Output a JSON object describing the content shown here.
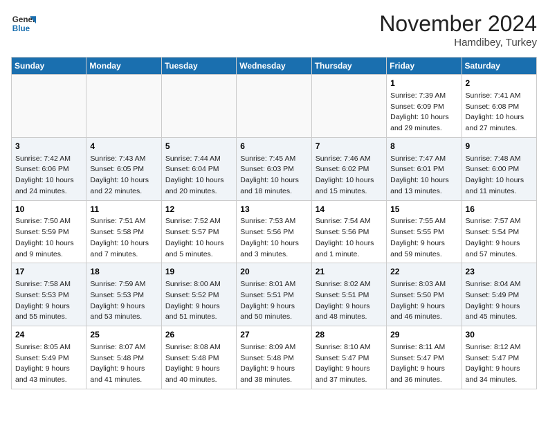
{
  "logo": {
    "line1": "General",
    "line2": "Blue"
  },
  "title": "November 2024",
  "location": "Hamdibey, Turkey",
  "days_of_week": [
    "Sunday",
    "Monday",
    "Tuesday",
    "Wednesday",
    "Thursday",
    "Friday",
    "Saturday"
  ],
  "weeks": [
    [
      {
        "day": "",
        "info": ""
      },
      {
        "day": "",
        "info": ""
      },
      {
        "day": "",
        "info": ""
      },
      {
        "day": "",
        "info": ""
      },
      {
        "day": "",
        "info": ""
      },
      {
        "day": "1",
        "info": "Sunrise: 7:39 AM\nSunset: 6:09 PM\nDaylight: 10 hours\nand 29 minutes."
      },
      {
        "day": "2",
        "info": "Sunrise: 7:41 AM\nSunset: 6:08 PM\nDaylight: 10 hours\nand 27 minutes."
      }
    ],
    [
      {
        "day": "3",
        "info": "Sunrise: 7:42 AM\nSunset: 6:06 PM\nDaylight: 10 hours\nand 24 minutes."
      },
      {
        "day": "4",
        "info": "Sunrise: 7:43 AM\nSunset: 6:05 PM\nDaylight: 10 hours\nand 22 minutes."
      },
      {
        "day": "5",
        "info": "Sunrise: 7:44 AM\nSunset: 6:04 PM\nDaylight: 10 hours\nand 20 minutes."
      },
      {
        "day": "6",
        "info": "Sunrise: 7:45 AM\nSunset: 6:03 PM\nDaylight: 10 hours\nand 18 minutes."
      },
      {
        "day": "7",
        "info": "Sunrise: 7:46 AM\nSunset: 6:02 PM\nDaylight: 10 hours\nand 15 minutes."
      },
      {
        "day": "8",
        "info": "Sunrise: 7:47 AM\nSunset: 6:01 PM\nDaylight: 10 hours\nand 13 minutes."
      },
      {
        "day": "9",
        "info": "Sunrise: 7:48 AM\nSunset: 6:00 PM\nDaylight: 10 hours\nand 11 minutes."
      }
    ],
    [
      {
        "day": "10",
        "info": "Sunrise: 7:50 AM\nSunset: 5:59 PM\nDaylight: 10 hours\nand 9 minutes."
      },
      {
        "day": "11",
        "info": "Sunrise: 7:51 AM\nSunset: 5:58 PM\nDaylight: 10 hours\nand 7 minutes."
      },
      {
        "day": "12",
        "info": "Sunrise: 7:52 AM\nSunset: 5:57 PM\nDaylight: 10 hours\nand 5 minutes."
      },
      {
        "day": "13",
        "info": "Sunrise: 7:53 AM\nSunset: 5:56 PM\nDaylight: 10 hours\nand 3 minutes."
      },
      {
        "day": "14",
        "info": "Sunrise: 7:54 AM\nSunset: 5:56 PM\nDaylight: 10 hours\nand 1 minute."
      },
      {
        "day": "15",
        "info": "Sunrise: 7:55 AM\nSunset: 5:55 PM\nDaylight: 9 hours\nand 59 minutes."
      },
      {
        "day": "16",
        "info": "Sunrise: 7:57 AM\nSunset: 5:54 PM\nDaylight: 9 hours\nand 57 minutes."
      }
    ],
    [
      {
        "day": "17",
        "info": "Sunrise: 7:58 AM\nSunset: 5:53 PM\nDaylight: 9 hours\nand 55 minutes."
      },
      {
        "day": "18",
        "info": "Sunrise: 7:59 AM\nSunset: 5:53 PM\nDaylight: 9 hours\nand 53 minutes."
      },
      {
        "day": "19",
        "info": "Sunrise: 8:00 AM\nSunset: 5:52 PM\nDaylight: 9 hours\nand 51 minutes."
      },
      {
        "day": "20",
        "info": "Sunrise: 8:01 AM\nSunset: 5:51 PM\nDaylight: 9 hours\nand 50 minutes."
      },
      {
        "day": "21",
        "info": "Sunrise: 8:02 AM\nSunset: 5:51 PM\nDaylight: 9 hours\nand 48 minutes."
      },
      {
        "day": "22",
        "info": "Sunrise: 8:03 AM\nSunset: 5:50 PM\nDaylight: 9 hours\nand 46 minutes."
      },
      {
        "day": "23",
        "info": "Sunrise: 8:04 AM\nSunset: 5:49 PM\nDaylight: 9 hours\nand 45 minutes."
      }
    ],
    [
      {
        "day": "24",
        "info": "Sunrise: 8:05 AM\nSunset: 5:49 PM\nDaylight: 9 hours\nand 43 minutes."
      },
      {
        "day": "25",
        "info": "Sunrise: 8:07 AM\nSunset: 5:48 PM\nDaylight: 9 hours\nand 41 minutes."
      },
      {
        "day": "26",
        "info": "Sunrise: 8:08 AM\nSunset: 5:48 PM\nDaylight: 9 hours\nand 40 minutes."
      },
      {
        "day": "27",
        "info": "Sunrise: 8:09 AM\nSunset: 5:48 PM\nDaylight: 9 hours\nand 38 minutes."
      },
      {
        "day": "28",
        "info": "Sunrise: 8:10 AM\nSunset: 5:47 PM\nDaylight: 9 hours\nand 37 minutes."
      },
      {
        "day": "29",
        "info": "Sunrise: 8:11 AM\nSunset: 5:47 PM\nDaylight: 9 hours\nand 36 minutes."
      },
      {
        "day": "30",
        "info": "Sunrise: 8:12 AM\nSunset: 5:47 PM\nDaylight: 9 hours\nand 34 minutes."
      }
    ]
  ]
}
